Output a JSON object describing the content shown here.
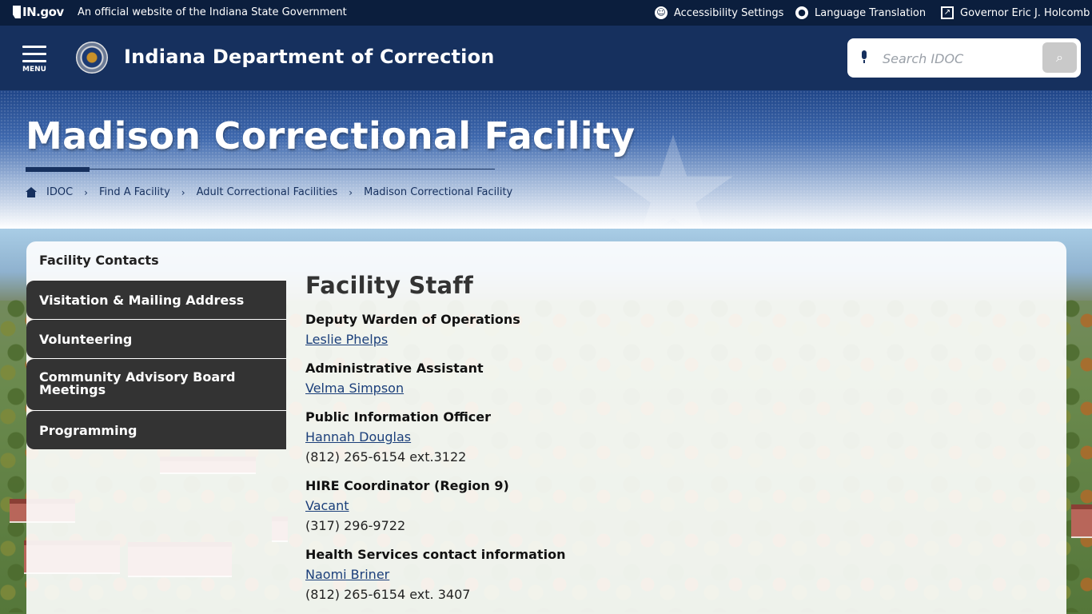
{
  "topbar": {
    "ingov_logo": "IN.gov",
    "official_text": "An official website of the Indiana State Government",
    "accessibility": "Accessibility Settings",
    "language": "Language Translation",
    "governor": "Governor Eric J. Holcomb"
  },
  "header": {
    "menu_label": "MENU",
    "agency_title": "Indiana Department of Correction",
    "search_placeholder": "Search IDOC"
  },
  "hero": {
    "title": "Madison Correctional Facility"
  },
  "breadcrumb": [
    "IDOC",
    "Find A Facility",
    "Adult Correctional Facilities",
    "Madison Correctional Facility"
  ],
  "sidenav": {
    "active": "Facility Contacts",
    "items": [
      "Visitation & Mailing Address",
      "Volunteering",
      "Community Advisory Board Meetings",
      "Programming"
    ]
  },
  "main": {
    "heading": "Facility Staff",
    "staff": [
      {
        "role": "Deputy Warden of Operations",
        "name": "Leslie Phelps",
        "phone": ""
      },
      {
        "role": "Administrative Assistant",
        "name": "Velma Simpson",
        "phone": ""
      },
      {
        "role": "Public Information Officer",
        "name": "Hannah Douglas",
        "phone": "(812) 265-6154 ext.3122"
      },
      {
        "role": "HIRE Coordinator (Region 9)",
        "name": "Vacant",
        "phone": "(317) 296-9722"
      },
      {
        "role": "Health Services contact information",
        "name": "Naomi Briner",
        "phone": "(812) 265-6154 ext. 3407"
      }
    ]
  },
  "colors": {
    "topbar": "#0b1e3d",
    "header": "#16305e",
    "nav_item": "#333333",
    "link": "#1b3f7a"
  }
}
